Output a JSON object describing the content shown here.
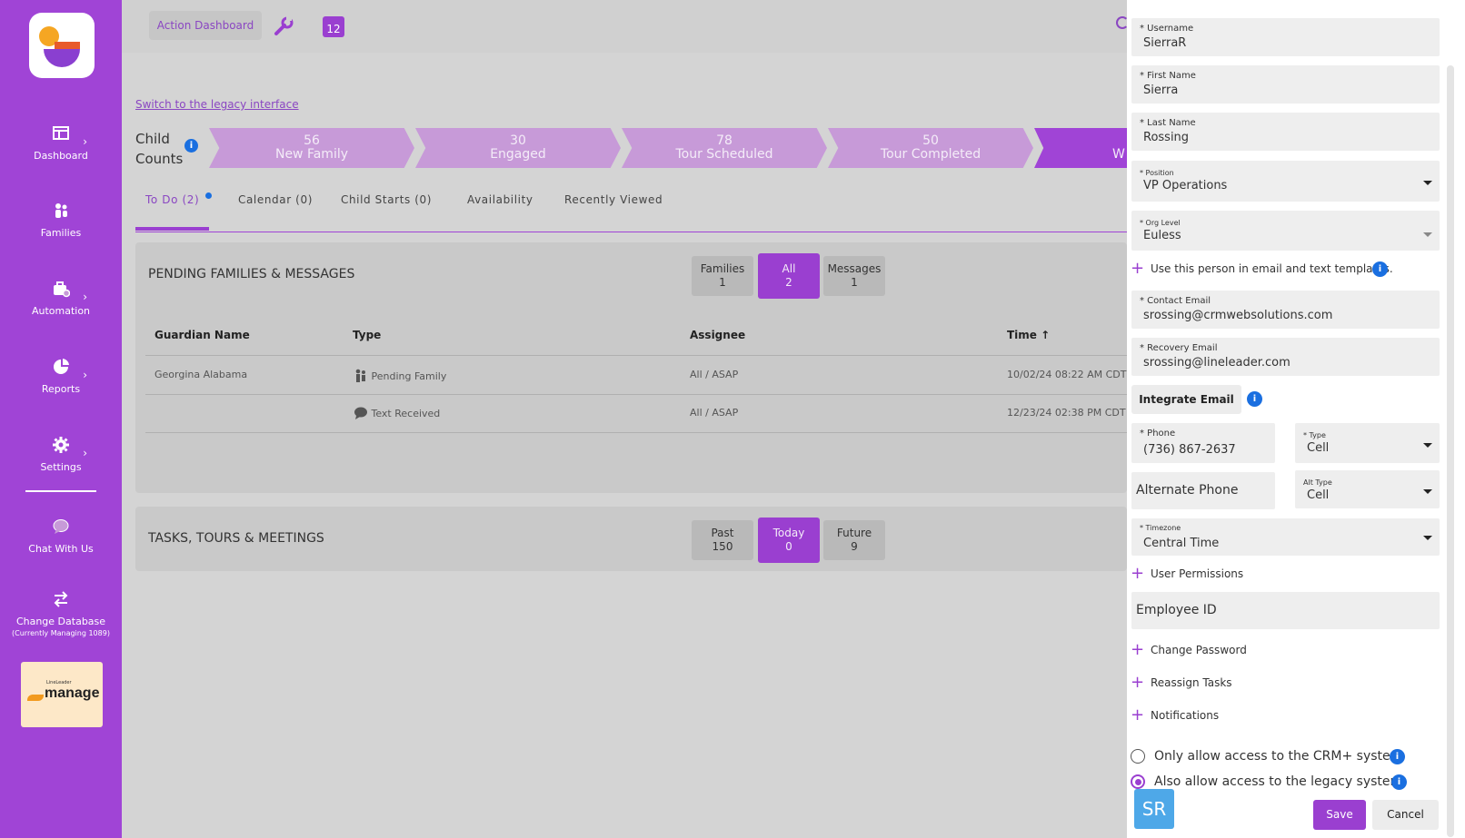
{
  "sidebar": {
    "items": [
      {
        "label": "Dashboard"
      },
      {
        "label": "Families"
      },
      {
        "label": "Automation"
      },
      {
        "label": "Reports"
      },
      {
        "label": "Settings"
      },
      {
        "label": "Chat With Us"
      },
      {
        "label": "Change Database",
        "sub": "(Currently Managing 1089)"
      }
    ],
    "manage_label": "manage",
    "manage_tag": "LineLeader"
  },
  "topbar": {
    "action_dashboard": "Action Dashboard",
    "calendar_day": "12"
  },
  "legacy_link": "Switch to the legacy interface",
  "pipeline": {
    "title_line1": "Child",
    "title_line2": "Counts",
    "stages": [
      {
        "count": "56",
        "label": "New Family"
      },
      {
        "count": "30",
        "label": "Engaged"
      },
      {
        "count": "78",
        "label": "Tour Scheduled"
      },
      {
        "count": "50",
        "label": "Tour Completed"
      },
      {
        "count": "",
        "label": "W"
      }
    ]
  },
  "tabs": [
    {
      "label": "To Do (2)"
    },
    {
      "label": "Calendar (0)"
    },
    {
      "label": "Child Starts (0)"
    },
    {
      "label": "Availability"
    },
    {
      "label": "Recently Viewed"
    }
  ],
  "pending": {
    "title": "PENDING FAMILIES & MESSAGES",
    "segments": [
      {
        "label": "Families",
        "count": "1"
      },
      {
        "label": "All",
        "count": "2"
      },
      {
        "label": "Messages",
        "count": "1"
      }
    ],
    "columns": [
      "Guardian Name",
      "Type",
      "Assignee",
      "Time"
    ],
    "rows": [
      {
        "guardian": "Georgina Alabama",
        "type": "Pending Family",
        "assignee": "All / ASAP",
        "time": "10/02/24 08:22 AM CDT"
      },
      {
        "guardian": "",
        "type": "Text Received",
        "assignee": "All / ASAP",
        "time": "12/23/24 02:38 PM CDT"
      }
    ]
  },
  "tasks": {
    "title": "TASKS, TOURS & MEETINGS",
    "segments": [
      {
        "label": "Past",
        "count": "150"
      },
      {
        "label": "Today",
        "count": "0"
      },
      {
        "label": "Future",
        "count": "9"
      }
    ]
  },
  "form": {
    "username_label": "* Username",
    "username": "SierraR",
    "first_label": "* First Name",
    "first": "Sierra",
    "last_label": "* Last Name",
    "last": "Rossing",
    "position_label": "* Position",
    "position": "VP Operations",
    "org_label": "* Org Level",
    "org": "Euless",
    "use_in_templates": "Use this person in email and text templates.",
    "contact_email_label": "* Contact Email",
    "contact_email": "srossing@crmwebsolutions.com",
    "recovery_email_label": "* Recovery Email",
    "recovery_email": "srossing@lineleader.com",
    "integrate_email": "Integrate Email",
    "phone_label": "* Phone",
    "phone": "(736) 867-2637",
    "type_label": "* Type",
    "type": "Cell",
    "alt_phone_placeholder": "Alternate Phone",
    "alt_type_label": "Alt Type",
    "alt_type": "Cell",
    "timezone_label": "* Timezone",
    "timezone": "Central Time",
    "user_permissions": "User Permissions",
    "employee_id_placeholder": "Employee ID",
    "change_password": "Change Password",
    "reassign_tasks": "Reassign Tasks",
    "notifications": "Notifications",
    "radio_crm": "Only allow access to the CRM+ system",
    "radio_legacy": "Also allow access to the legacy system",
    "save": "Save",
    "cancel": "Cancel",
    "avatar": "SR"
  },
  "colors": {
    "brand": "#a044d6",
    "info": "#1a6fe0",
    "avatar": "#4ea8e8"
  }
}
